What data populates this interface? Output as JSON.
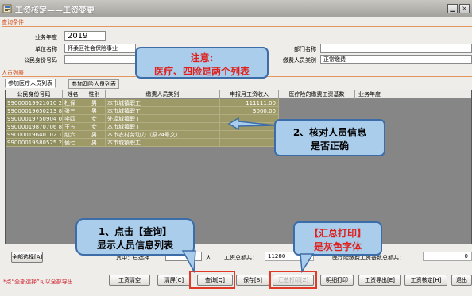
{
  "window": {
    "title": "工资核定——工资变更",
    "minimize_glyph": "▁",
    "close_glyph": "×"
  },
  "query": {
    "section_label": "查询条件",
    "year_label": "业务年度",
    "year_value": "2019",
    "unit_label": "单位名称",
    "unit_value": "怀柔区社会保险事业",
    "dept_label": "部门名称",
    "dept_value": "",
    "id_label": "公民身份号码",
    "id_value": "",
    "payer_type_label": "缴费人员类别",
    "payer_type_value": "正常缴费"
  },
  "people": {
    "section_label": "人员列表",
    "tabs": [
      "参加医疗人员列表",
      "参加四险人员列表"
    ],
    "columns": [
      "公民身份号码",
      "姓名",
      "性别",
      "缴费人员类别",
      "申报月工资收入",
      "医疗险的缴费工资基数",
      "业务年度"
    ],
    "rows": [
      [
        "99000019921010 2514",
        "杜保",
        "男",
        "本市城镇职工",
        "111111.00",
        "",
        ""
      ],
      [
        "99000019650213 8412",
        "张三",
        "男",
        "本市城镇职工",
        "3000.00",
        "",
        ""
      ],
      [
        "99000019750904 0223",
        "李四",
        "女",
        "外埠城镇职工",
        "",
        "",
        ""
      ],
      [
        "99000019870706 8125",
        "王五",
        "女",
        "本市城镇职工",
        "",
        "",
        ""
      ],
      [
        "99000019640102 1317",
        "赵六",
        "男",
        "本市农村劳动力（原24号文）",
        "",
        "",
        ""
      ],
      [
        "99000019580525 2011",
        "侯七",
        "男",
        "本市城镇职工",
        "",
        "",
        ""
      ]
    ]
  },
  "footer": {
    "select_all": "全部选择[A]",
    "selected_prefix": "其中：已选择",
    "selected_suffix": "人",
    "wage_total_label": "工资总额共：",
    "wage_total_value": "11280",
    "base_total_label": "医疗险缴费工资基数总额共：",
    "base_total_value": "0",
    "hint": "*点“全部选择”可以全部导出",
    "buttons": [
      "工资清空",
      "清屏[C]",
      "查询[Q]",
      "保存[S]",
      "汇总打印[Z]",
      "明细打印",
      "工资导出[E]",
      "工资核定[H]",
      "退出"
    ]
  },
  "annotations": {
    "note_title": "注意:",
    "note_body": "医疗、四险是两个列表",
    "check_line1": "2、核对人员信息",
    "check_line2": "是否正确",
    "query_line1": "1、点击【查询】",
    "query_line2": "显示人员信息列表",
    "print_line1": "【汇总打印】",
    "print_line2": "是灰色字体"
  },
  "colors": {
    "callout_bg": "#a9cdeb",
    "callout_border": "#3d6da8",
    "note_text": "#e0201c",
    "highlight": "#e23a28",
    "row_bg": "#9e9a68",
    "grid_bg": "#868686",
    "section_text": "#d24f1a"
  }
}
